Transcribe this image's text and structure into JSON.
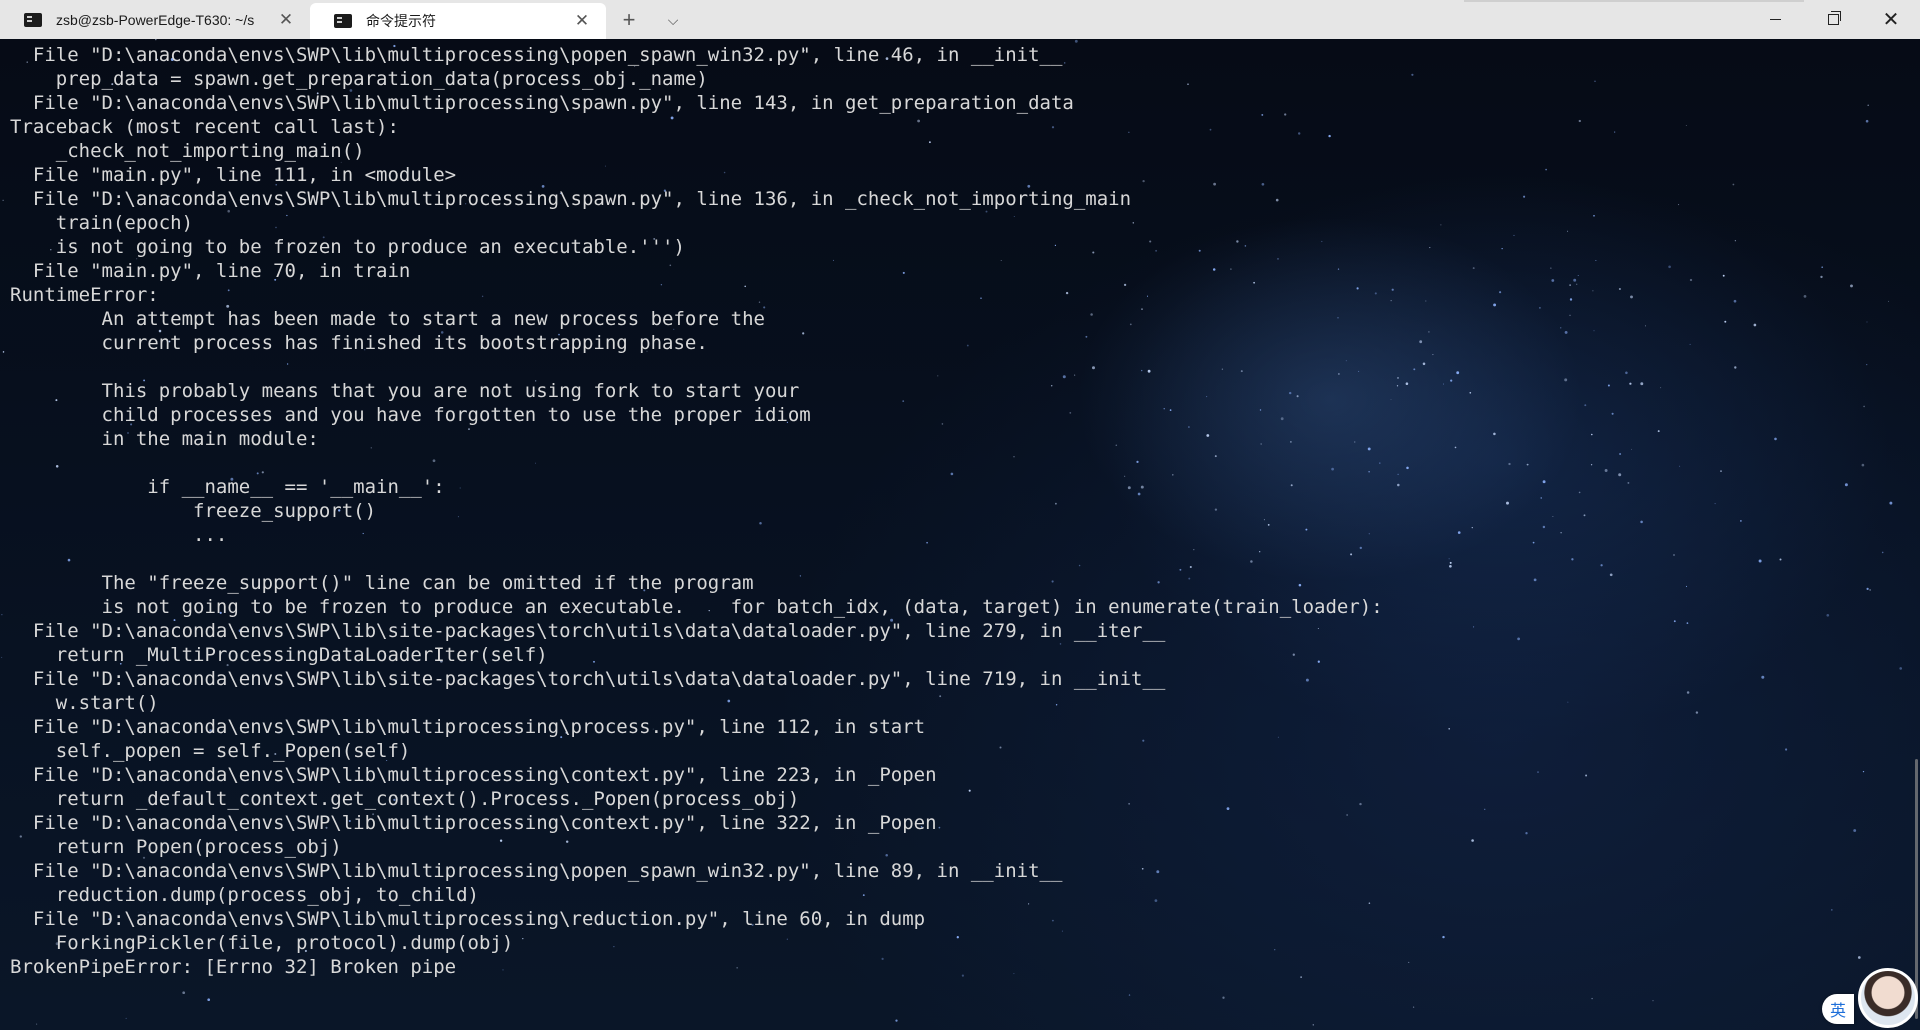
{
  "tabs": [
    {
      "label": "zsb@zsb-PowerEdge-T630: ~/s",
      "active": false
    },
    {
      "label": "命令提示符",
      "active": true
    }
  ],
  "tab_actions": {
    "new_tab_icon": "plus-icon",
    "dropdown_icon": "chevron-down-icon"
  },
  "window_controls": {
    "minimize_icon": "minimize-icon",
    "maximize_icon": "restore-icon",
    "close_icon": "close-icon"
  },
  "terminal": {
    "lines": [
      "  File \"D:\\anaconda\\envs\\SWP\\lib\\multiprocessing\\popen_spawn_win32.py\", line 46, in __init__",
      "    prep_data = spawn.get_preparation_data(process_obj._name)",
      "  File \"D:\\anaconda\\envs\\SWP\\lib\\multiprocessing\\spawn.py\", line 143, in get_preparation_data",
      "Traceback (most recent call last):",
      "    _check_not_importing_main()",
      "  File \"main.py\", line 111, in <module>",
      "  File \"D:\\anaconda\\envs\\SWP\\lib\\multiprocessing\\spawn.py\", line 136, in _check_not_importing_main",
      "    train(epoch)",
      "    is not going to be frozen to produce an executable.''')",
      "  File \"main.py\", line 70, in train",
      "RuntimeError:",
      "        An attempt has been made to start a new process before the",
      "        current process has finished its bootstrapping phase.",
      "",
      "        This probably means that you are not using fork to start your",
      "        child processes and you have forgotten to use the proper idiom",
      "        in the main module:",
      "",
      "            if __name__ == '__main__':",
      "                freeze_support()",
      "                ...",
      "",
      "        The \"freeze_support()\" line can be omitted if the program",
      "        is not going to be frozen to produce an executable.    for batch_idx, (data, target) in enumerate(train_loader):",
      "  File \"D:\\anaconda\\envs\\SWP\\lib\\site-packages\\torch\\utils\\data\\dataloader.py\", line 279, in __iter__",
      "    return _MultiProcessingDataLoaderIter(self)",
      "  File \"D:\\anaconda\\envs\\SWP\\lib\\site-packages\\torch\\utils\\data\\dataloader.py\", line 719, in __init__",
      "    w.start()",
      "  File \"D:\\anaconda\\envs\\SWP\\lib\\multiprocessing\\process.py\", line 112, in start",
      "    self._popen = self._Popen(self)",
      "  File \"D:\\anaconda\\envs\\SWP\\lib\\multiprocessing\\context.py\", line 223, in _Popen",
      "    return _default_context.get_context().Process._Popen(process_obj)",
      "  File \"D:\\anaconda\\envs\\SWP\\lib\\multiprocessing\\context.py\", line 322, in _Popen",
      "    return Popen(process_obj)",
      "  File \"D:\\anaconda\\envs\\SWP\\lib\\multiprocessing\\popen_spawn_win32.py\", line 89, in __init__",
      "    reduction.dump(process_obj, to_child)",
      "  File \"D:\\anaconda\\envs\\SWP\\lib\\multiprocessing\\reduction.py\", line 60, in dump",
      "    ForkingPickler(file, protocol).dump(obj)",
      "BrokenPipeError: [Errno 32] Broken pipe"
    ]
  },
  "ime": {
    "label": "英"
  },
  "colors": {
    "tabbar": "#e6e6e6",
    "active_tab": "#ffffff",
    "terminal_text": "#d8d8d8",
    "terminal_bg": "#07101f"
  }
}
